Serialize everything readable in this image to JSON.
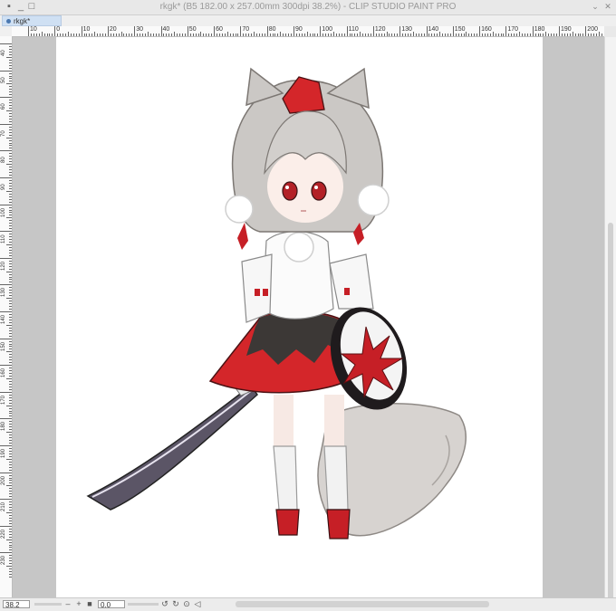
{
  "window": {
    "title": "rkgk* (B5 182.00 x 257.00mm 300dpi 38.2%)  - CLIP STUDIO PAINT PRO",
    "collapse_glyph": "⌄",
    "close_glyph": "✕"
  },
  "tab": {
    "label": "rkgk*"
  },
  "ruler_h_labels": [
    "10",
    "0",
    "10",
    "20",
    "30",
    "40",
    "50",
    "60",
    "70",
    "80",
    "90",
    "100",
    "110",
    "120",
    "130",
    "140",
    "150",
    "160",
    "170",
    "180",
    "190",
    "200"
  ],
  "ruler_v_labels": [
    "40",
    "50",
    "60",
    "70",
    "80",
    "90",
    "100",
    "110",
    "120",
    "130",
    "140",
    "150",
    "160",
    "170",
    "180",
    "190",
    "200",
    "210",
    "220",
    "230"
  ],
  "status": {
    "zoom": "38.2",
    "rotation": "0.0",
    "minus": "–",
    "plus": "+"
  },
  "colors": {
    "workspace": "#c6c6c6",
    "canvas": "#ffffff",
    "accent_red": "#d4262a",
    "hair": "#c9c6c3"
  }
}
